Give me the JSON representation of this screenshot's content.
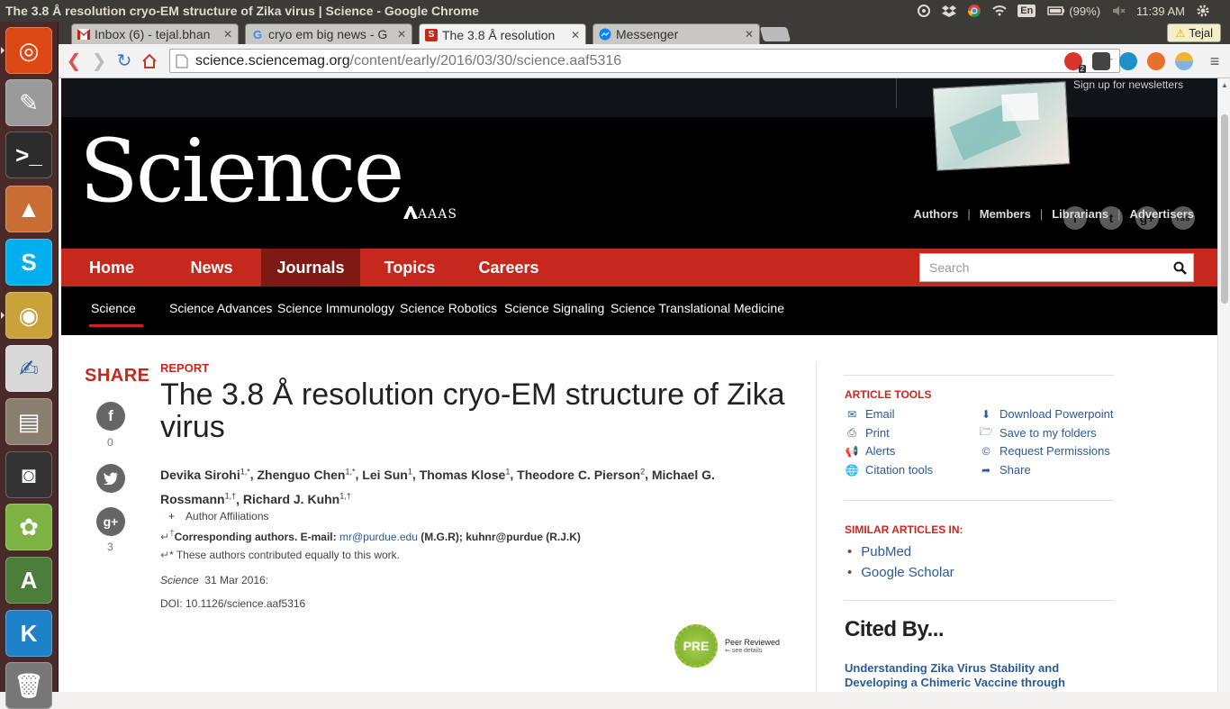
{
  "os": {
    "window_title": "The 3.8 Å resolution cryo-EM structure of Zika virus | Science - Google Chrome",
    "battery": "(99%)",
    "clock": "11:39 AM",
    "keyboard": "En",
    "tray_icons": [
      "dropbox-icon",
      "chrome-icon",
      "wifi-icon",
      "battery-icon",
      "volume-mute-icon",
      "power-icon"
    ],
    "launcher": [
      {
        "name": "ubuntu-dash-icon",
        "color": "#dd4814"
      },
      {
        "name": "system-settings-icon",
        "color": "#9a9a9a"
      },
      {
        "name": "terminal-icon",
        "color": "#2c2c2c"
      },
      {
        "name": "matlab-icon",
        "color": "#c96d35"
      },
      {
        "name": "skype-icon",
        "color": "#00aff0"
      },
      {
        "name": "chrome-launcher-icon",
        "color": "#c9a23a"
      },
      {
        "name": "libreoffice-icon",
        "color": "#d9d9d9"
      },
      {
        "name": "file-manager-icon",
        "color": "#8a7f6e"
      },
      {
        "name": "disk-icon",
        "color": "#333333"
      },
      {
        "name": "picasa-icon",
        "color": "#7cb342"
      },
      {
        "name": "software-updater-icon",
        "color": "#4c7d3a"
      },
      {
        "name": "kile-icon",
        "color": "#1f82c9"
      },
      {
        "name": "trash-icon",
        "color": "#777777"
      }
    ]
  },
  "browser": {
    "tabs": [
      {
        "label": "Inbox (6) - tejal.bhan",
        "favicon": "gmail-icon",
        "color": "#c5221f"
      },
      {
        "label": "cryo em big news - G",
        "favicon": "google-icon",
        "color": "#4285f4"
      },
      {
        "label": "The 3.8 Å resolution",
        "favicon": "science-icon",
        "color": "#c7281e",
        "active": true
      },
      {
        "label": "Messenger",
        "favicon": "messenger-icon",
        "color": "#0084ff"
      }
    ],
    "profile": "Tejal",
    "url_host": "science.sciencemag.org",
    "url_path": "/content/early/2016/03/30/science.aaf5316",
    "ext_badge": "2"
  },
  "site": {
    "newsletter": "Sign up for newsletters",
    "logo": "Science",
    "aaas": "AAAS",
    "social": [
      "f",
      "t",
      "g+",
      "rss"
    ],
    "top_links": [
      "Authors",
      "Members",
      "Librarians",
      "Advertisers"
    ],
    "main_nav": [
      "Home",
      "News",
      "Journals",
      "Topics",
      "Careers"
    ],
    "active_nav": "Journals",
    "search_placeholder": "Search",
    "sub_nav": [
      "Science",
      "Science Advances",
      "Science Immunology",
      "Science Robotics",
      "Science Signaling",
      "Science Translational Medicine"
    ]
  },
  "article": {
    "share_heading": "SHARE",
    "share_counts": {
      "facebook": "0",
      "google": "3"
    },
    "type": "REPORT",
    "title": "The 3.8 Å resolution cryo-EM structure of Zika virus",
    "authors": [
      {
        "name": "Devika Sirohi",
        "sup": "1,*"
      },
      {
        "name": "Zhenguo Chen",
        "sup": "1,*"
      },
      {
        "name": "Lei Sun",
        "sup": "1"
      },
      {
        "name": "Thomas Klose",
        "sup": "1"
      },
      {
        "name": "Theodore C. Pierson",
        "sup": "2"
      },
      {
        "name": "Michael G. Rossmann",
        "sup": "1,†"
      },
      {
        "name": "Richard J. Kuhn",
        "sup": "1,†"
      }
    ],
    "affiliations_label": "Author Affiliations",
    "corr_prefix": "Corresponding authors. E-mail:",
    "corr_email1": "mr@purdue.edu",
    "corr_mid": "(M.G.R); kuhnr@purdue (R.J.K)",
    "equal_note": "* These authors contributed equally to this work.",
    "journal": "Science",
    "date": "31 Mar 2016:",
    "doi": "DOI: 10.1126/science.aaf5316",
    "peer_badge": "PRE",
    "peer_title": "Peer Reviewed",
    "peer_details": "see details"
  },
  "sidebar": {
    "tools_heading": "ARTICLE TOOLS",
    "tools_left": [
      "Email",
      "Print",
      "Alerts",
      "Citation tools"
    ],
    "tools_right": [
      "Download Powerpoint",
      "Save to my folders",
      "Request Permissions",
      "Share"
    ],
    "similar_heading": "SIMILAR ARTICLES IN:",
    "similar": [
      "PubMed",
      "Google Scholar"
    ],
    "cited_heading": "Cited By...",
    "cited_article": "Understanding Zika Virus Stability and Developing a Chimeric Vaccine through Functional Analysis"
  }
}
